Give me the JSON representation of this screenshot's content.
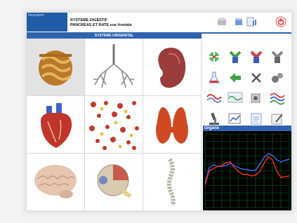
{
  "app": {
    "logo_text": "biosystem"
  },
  "header": {
    "title": "SYSTEME DIGESTIF",
    "subtitle": "PANCREAS ET RATE vue frontale"
  },
  "section": {
    "title": "SYSTEME URIGENITAL"
  },
  "organs": [
    "intestines",
    "lungs",
    "kidney",
    "heart",
    "blood-cells",
    "thyroid",
    "brain",
    "eye",
    "spine"
  ],
  "chart": {
    "title": "Organe"
  },
  "chart_data": {
    "type": "line",
    "title": "Organe",
    "ylim": [
      0,
      10
    ],
    "grid": true,
    "series": [
      {
        "color": "#3b6bff",
        "x": [
          0,
          1,
          2,
          3,
          4,
          5,
          6,
          7,
          8,
          9,
          10,
          11,
          12,
          13,
          14,
          15,
          16,
          17,
          18,
          19,
          20
        ],
        "values": [
          3.3,
          5.4,
          5.8,
          5.6,
          5.6,
          5.7,
          6.0,
          5.7,
          5.4,
          5.2,
          5.2,
          5.0,
          5.1,
          5.9,
          6.8,
          7.3,
          7.1,
          6.5,
          6.2,
          6.4,
          6.6
        ]
      },
      {
        "color": "#ff2a1f",
        "x": [
          0,
          1,
          2,
          3,
          4,
          5,
          6,
          7,
          8,
          9,
          10,
          11,
          12,
          13,
          14,
          15,
          16,
          17,
          18,
          19,
          20
        ],
        "values": [
          3.1,
          5.0,
          5.3,
          5.6,
          5.7,
          6.1,
          6.2,
          5.4,
          4.9,
          4.5,
          4.5,
          4.3,
          4.4,
          4.9,
          6.0,
          6.9,
          6.5,
          5.0,
          4.1,
          4.2,
          4.3
        ]
      }
    ]
  }
}
